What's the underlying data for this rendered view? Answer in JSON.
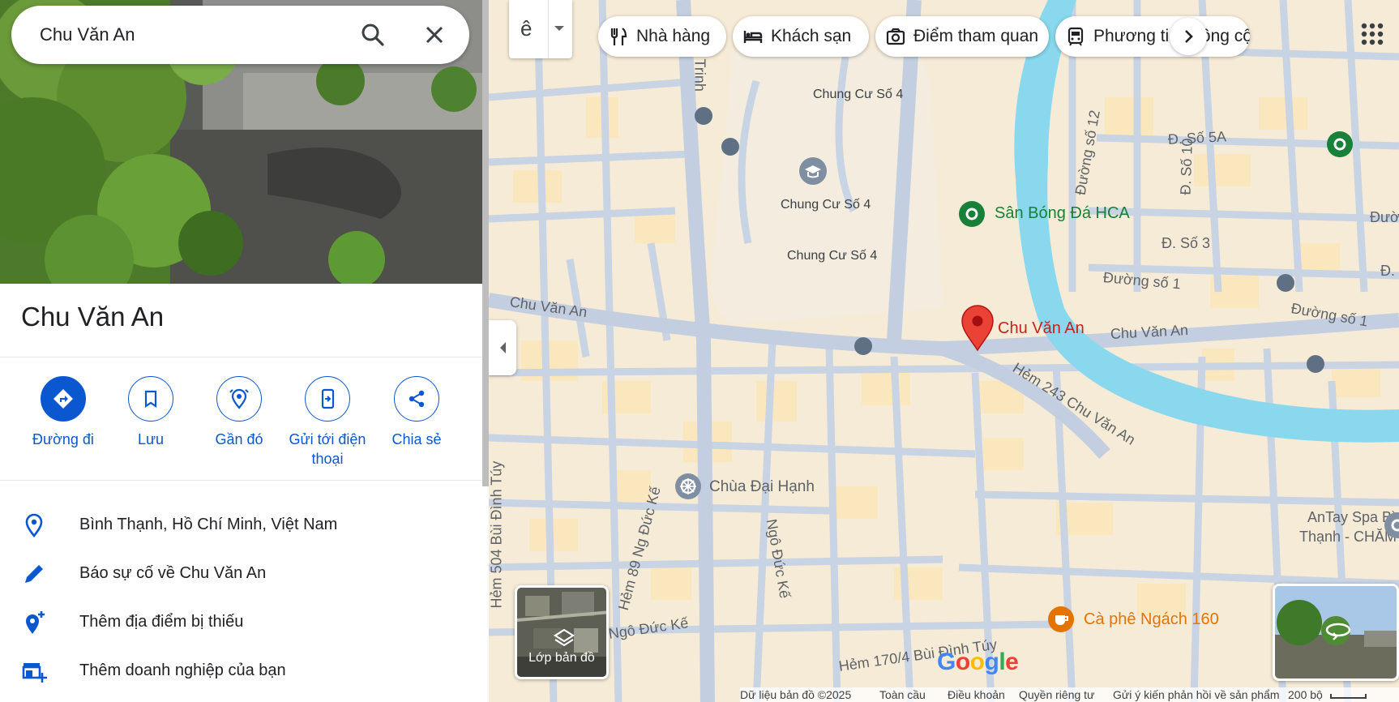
{
  "search": {
    "value": "Chu Văn An",
    "search_icon": "search-icon",
    "clear_icon": "close-icon"
  },
  "place": {
    "title": "Chu Văn An"
  },
  "actions": [
    {
      "label": "Đường đi",
      "icon": "directions-icon"
    },
    {
      "label": "Lưu",
      "icon": "bookmark-icon"
    },
    {
      "label": "Gần đó",
      "icon": "nearby-icon"
    },
    {
      "label": "Gửi tới điện thoại",
      "icon": "send-to-phone-icon"
    },
    {
      "label": "Chia sẻ",
      "icon": "share-icon"
    }
  ],
  "info": [
    {
      "text": "Bình Thạnh, Hồ Chí Minh, Việt Nam",
      "icon": "location-pin-icon"
    },
    {
      "text": "Báo sự cố về Chu Văn An",
      "icon": "pencil-icon"
    },
    {
      "text": "Thêm địa điểm bị thiếu",
      "icon": "add-place-icon"
    },
    {
      "text": "Thêm doanh nghiệp của bạn",
      "icon": "add-business-icon"
    }
  ],
  "map": {
    "lang_char": "ê",
    "chips": [
      {
        "label": "Nhà hàng",
        "icon": "restaurant-icon"
      },
      {
        "label": "Khách sạn",
        "icon": "hotel-icon"
      },
      {
        "label": "Điểm tham quan",
        "icon": "camera-icon"
      },
      {
        "label": "Phương tiện công cộng",
        "icon": "transit-icon"
      }
    ],
    "labels": {
      "chung_cu_1": "Chung Cư Số 4",
      "chung_cu_2": "Chung Cư Số 4",
      "chung_cu_3": "Chung Cư Số 4",
      "san_bong": "Sân Bóng Đá HCA",
      "pin_label": "Chu Văn An",
      "chua": "Chùa Đại Hạnh",
      "cafe": "Cà phê Ngách 160",
      "spa_1": "AnTay Spa Bình",
      "spa_2": "Thạnh - CHĂM DA..."
    },
    "streets": {
      "chu_van_an_left": "Chu Văn An",
      "chu_van_an_right": "Chu Văn An",
      "hem_243": "Hẻm 243 Chu Văn An",
      "trinh": "Trinh",
      "hem_504": "Hẻm 504 Bùi Đình Túy",
      "hem_89": "Hẻm 89 Ng Đức Kế",
      "ngo_duc_ke_v": "Ngô Đức Kế",
      "ngo_duc_ke_h": "Ngô Đức Kế",
      "hem_170": "Hẻm 170/4 Bùi Đình Túy",
      "d_so_5a": "Đ. Số 5A",
      "d_so_3": "Đ. Số 3",
      "duong_so_1_a": "Đường số 1",
      "duong_so_1_b": "Đường số 1",
      "duong_so_12": "Đường số 12",
      "d_so_10": "Đ. Số 10",
      "duon": "Đườn",
      "d_edge": "Đ."
    },
    "layers_label": "Lớp bản đồ",
    "footer": {
      "data": "Dữ liệu bản đồ ©2025",
      "global": "Toàn cầu",
      "terms": "Điều khoản",
      "privacy": "Quyền riêng tư",
      "feedback": "Gửi ý kiến phản hồi về sản phẩm",
      "scale": "200 bộ"
    }
  },
  "colors": {
    "accent": "#0b57d0",
    "pin": "#ea4335",
    "river": "#89d8ee",
    "park": "#188038",
    "cafe": "#e37400"
  }
}
